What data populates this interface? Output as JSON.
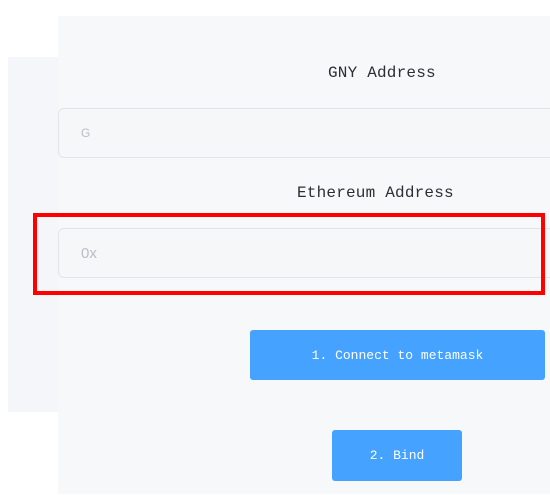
{
  "form": {
    "gny_label": "GNY Address",
    "gny_placeholder": "G",
    "eth_label": "Ethereum Address",
    "eth_placeholder": "0x"
  },
  "actions": {
    "connect_label": "1. Connect to metamask",
    "bind_label": "2. Bind"
  },
  "colors": {
    "button": "#45a2ff",
    "highlight": "#ff0000",
    "panel": "#f7f8fa"
  }
}
